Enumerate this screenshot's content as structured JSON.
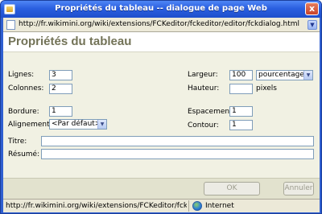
{
  "window": {
    "title": "Propriétés du tableau -- dialogue de page Web",
    "close_label": "x"
  },
  "address_bar": {
    "url": "http://fr.wikimini.org/wiki/extensions/FCKeditor/fckeditor/editor/fckdialog.html"
  },
  "dialog": {
    "heading": "Propriétés du tableau",
    "fields": {
      "rows": {
        "label": "Lignes:",
        "value": "3"
      },
      "columns": {
        "label": "Colonnes:",
        "value": "2"
      },
      "width": {
        "label": "Largeur:",
        "value": "100",
        "unit": "pourcentage"
      },
      "height": {
        "label": "Hauteur:",
        "value": "",
        "unit": "pixels"
      },
      "border": {
        "label": "Bordure:",
        "value": "1"
      },
      "alignment": {
        "label": "Alignement:",
        "value": "<Par défaut>"
      },
      "spacing": {
        "label": "Espacement:",
        "value": "1"
      },
      "padding": {
        "label": "Contour:",
        "value": "1"
      },
      "caption": {
        "label": "Titre:",
        "value": ""
      },
      "summary": {
        "label": "Résumé:",
        "value": ""
      }
    },
    "buttons": {
      "ok": "OK",
      "cancel": "Annuler"
    }
  },
  "status_bar": {
    "text": "http://fr.wikimini.org/wiki/extensions/FCKeditor/fckeditor/",
    "zone": "Internet"
  },
  "icons": {
    "window_icon": "app-icon",
    "page_icon": "page-icon",
    "zone_icon": "globe-icon"
  }
}
